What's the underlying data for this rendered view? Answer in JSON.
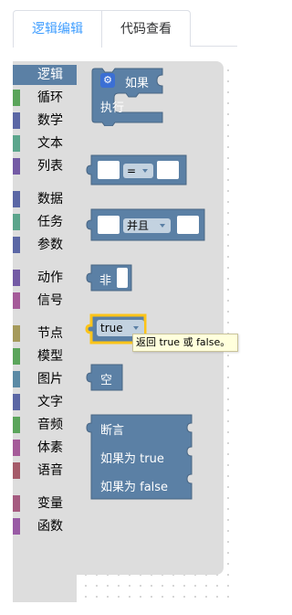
{
  "tabs": [
    {
      "label": "逻辑编辑",
      "active": true
    },
    {
      "label": "代码查看",
      "active": false
    }
  ],
  "toolbox": {
    "categories": [
      {
        "label": "逻辑",
        "color": "#5b80a5",
        "selected": true
      },
      {
        "label": "循环",
        "color": "#5ba55b"
      },
      {
        "label": "数学",
        "color": "#5b67a5"
      },
      {
        "label": "文本",
        "color": "#5ba58c"
      },
      {
        "label": "列表",
        "color": "#745ba5"
      },
      {
        "label": "数据",
        "color": "#5b67a5"
      },
      {
        "label": "任务",
        "color": "#5ba58c"
      },
      {
        "label": "参数",
        "color": "#5b67a5"
      },
      {
        "label": "动作",
        "color": "#745ba5"
      },
      {
        "label": "信号",
        "color": "#a55b99"
      },
      {
        "label": "节点",
        "color": "#a59a5b"
      },
      {
        "label": "模型",
        "color": "#5ba55b"
      },
      {
        "label": "图片",
        "color": "#5b8aa5"
      },
      {
        "label": "文字",
        "color": "#5b67a5"
      },
      {
        "label": "音频",
        "color": "#5ba55b"
      },
      {
        "label": "体素",
        "color": "#a55b99"
      },
      {
        "label": "语音",
        "color": "#a55b6a"
      },
      {
        "label": "变量",
        "color": "#a55b80"
      },
      {
        "label": "函数",
        "color": "#995ba5"
      }
    ]
  },
  "blocks": {
    "if_label": "如果",
    "do_label": "执行",
    "compare_op": "=",
    "logic_op": "并且",
    "not_label": "非",
    "boolean_value": "true",
    "null_label": "空",
    "ternary_label": "断言",
    "ternary_true": "如果为 true",
    "ternary_false": "如果为 false",
    "gear_icon": "gear-icon"
  },
  "tooltip": {
    "text": "返回 true 或 false。"
  },
  "colors": {
    "block": "#5b80a5",
    "block_stroke": "#496684",
    "tab_active": "#409eff",
    "highlight": "#fcc419"
  }
}
